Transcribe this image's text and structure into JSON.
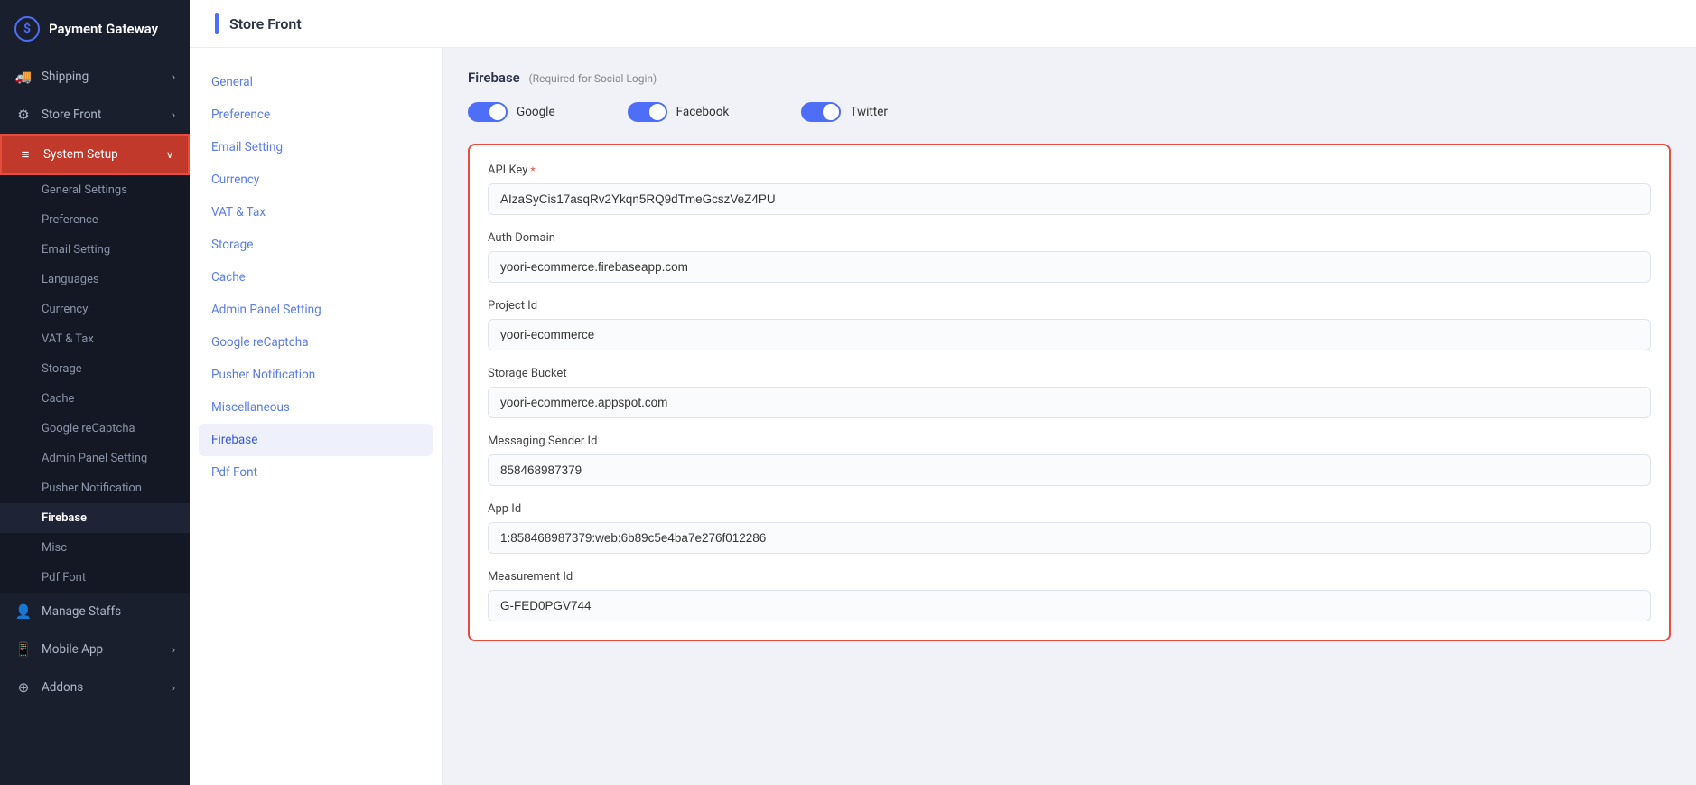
{
  "sidebar": {
    "logo": {
      "icon": "$",
      "title": "Payment Gateway"
    },
    "items": [
      {
        "id": "payment-gateway",
        "label": "Payment Gateway",
        "icon": "$",
        "hasChevron": false
      },
      {
        "id": "shipping",
        "label": "Shipping",
        "icon": "🚚",
        "hasChevron": true
      },
      {
        "id": "store-front",
        "label": "Store Front",
        "icon": "⚙️",
        "hasChevron": true
      },
      {
        "id": "system-setup",
        "label": "System Setup",
        "icon": "≡",
        "hasChevron": true,
        "expanded": true
      }
    ],
    "submenu": [
      {
        "id": "general-settings",
        "label": "General Settings"
      },
      {
        "id": "preference",
        "label": "Preference"
      },
      {
        "id": "email-setting",
        "label": "Email Setting"
      },
      {
        "id": "languages",
        "label": "Languages"
      },
      {
        "id": "currency",
        "label": "Currency"
      },
      {
        "id": "vat-tax",
        "label": "VAT & Tax"
      },
      {
        "id": "storage",
        "label": "Storage"
      },
      {
        "id": "cache",
        "label": "Cache"
      },
      {
        "id": "google-recaptcha",
        "label": "Google reCaptcha"
      },
      {
        "id": "admin-panel-setting",
        "label": "Admin Panel Setting"
      },
      {
        "id": "pusher-notification",
        "label": "Pusher Notification"
      },
      {
        "id": "firebase",
        "label": "Firebase",
        "active": true
      },
      {
        "id": "misc",
        "label": "Misc"
      },
      {
        "id": "pdf-font",
        "label": "Pdf Font"
      }
    ],
    "bottom_items": [
      {
        "id": "manage-staffs",
        "label": "Manage Staffs",
        "icon": "👤",
        "hasChevron": false
      },
      {
        "id": "mobile-app",
        "label": "Mobile App",
        "icon": "📱",
        "hasChevron": true
      },
      {
        "id": "addons",
        "label": "Addons",
        "icon": "⊕",
        "hasChevron": true
      }
    ]
  },
  "page": {
    "title": "Store Front"
  },
  "secondary_nav": {
    "items": [
      {
        "id": "general",
        "label": "General"
      },
      {
        "id": "preference",
        "label": "Preference"
      },
      {
        "id": "email-setting",
        "label": "Email Setting"
      },
      {
        "id": "currency",
        "label": "Currency"
      },
      {
        "id": "vat-tax",
        "label": "VAT & Tax"
      },
      {
        "id": "storage",
        "label": "Storage"
      },
      {
        "id": "cache",
        "label": "Cache"
      },
      {
        "id": "admin-panel-setting",
        "label": "Admin Panel Setting"
      },
      {
        "id": "google-recaptcha",
        "label": "Google reCaptcha"
      },
      {
        "id": "pusher-notification",
        "label": "Pusher Notification"
      },
      {
        "id": "miscellaneous",
        "label": "Miscellaneous"
      },
      {
        "id": "firebase",
        "label": "Firebase",
        "active": true
      },
      {
        "id": "pdf-font",
        "label": "Pdf Font"
      }
    ]
  },
  "firebase": {
    "title": "Firebase",
    "subtitle": "(Required for Social Login)",
    "toggles": [
      {
        "id": "google",
        "label": "Google",
        "enabled": true
      },
      {
        "id": "facebook",
        "label": "Facebook",
        "enabled": true
      },
      {
        "id": "twitter",
        "label": "Twitter",
        "enabled": true
      }
    ],
    "fields": [
      {
        "id": "api-key",
        "label": "API Key",
        "required": true,
        "value": "AIzaSyCis17asqRv2Ykqn5RQ9dTmeGcszVeZ4PU"
      },
      {
        "id": "auth-domain",
        "label": "Auth Domain",
        "required": false,
        "value": "yoori-ecommerce.firebaseapp.com"
      },
      {
        "id": "project-id",
        "label": "Project Id",
        "required": false,
        "value": "yoori-ecommerce"
      },
      {
        "id": "storage-bucket",
        "label": "Storage Bucket",
        "required": false,
        "value": "yoori-ecommerce.appspot.com"
      },
      {
        "id": "messaging-sender-id",
        "label": "Messaging Sender Id",
        "required": false,
        "value": "858468987379"
      },
      {
        "id": "app-id",
        "label": "App Id",
        "required": false,
        "value": "1:858468987379:web:6b89c5e4ba7e276f012286"
      },
      {
        "id": "measurement-id",
        "label": "Measurement Id",
        "required": false,
        "value": "G-FED0PGV744"
      }
    ]
  }
}
